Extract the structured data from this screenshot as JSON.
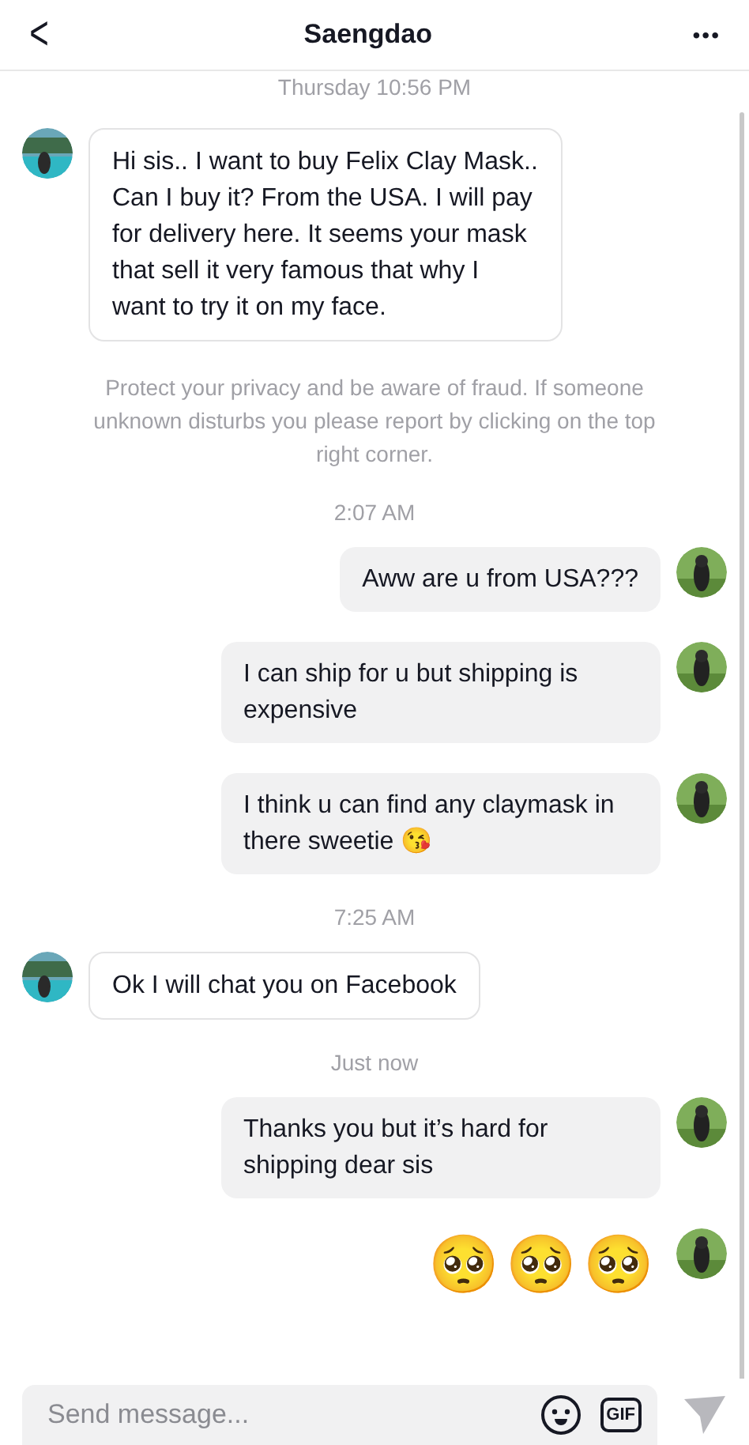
{
  "header": {
    "back": "<",
    "title": "Saengdao",
    "more": "•••"
  },
  "messages": [
    {
      "kind": "time",
      "text": "Thursday 10:56 PM"
    },
    {
      "kind": "incoming",
      "text": "Hi sis..  I want to buy Felix Clay Mask.. Can I buy it? From the USA. I will pay for delivery here. It seems your mask that sell it very famous that why I want to try it on my face."
    },
    {
      "kind": "notice",
      "text": "Protect your privacy and be aware of fraud. If someone unknown disturbs you please report by clicking on the top right corner."
    },
    {
      "kind": "time",
      "text": "2:07 AM"
    },
    {
      "kind": "outgoing",
      "text": "Aww are u from USA???"
    },
    {
      "kind": "outgoing",
      "text": "I can ship for u but shipping is expensive"
    },
    {
      "kind": "outgoing",
      "text": "I think u can find any claymask in there sweetie 😘"
    },
    {
      "kind": "time",
      "text": "7:25 AM"
    },
    {
      "kind": "incoming",
      "text": "Ok I will chat you on Facebook"
    },
    {
      "kind": "time",
      "text": "Just now"
    },
    {
      "kind": "outgoing",
      "text": "Thanks you but it’s hard for shipping dear sis"
    },
    {
      "kind": "emoji",
      "text": "🥺🥺🥺"
    }
  ],
  "composer": {
    "placeholder": "Send message...",
    "gif": "GIF"
  }
}
